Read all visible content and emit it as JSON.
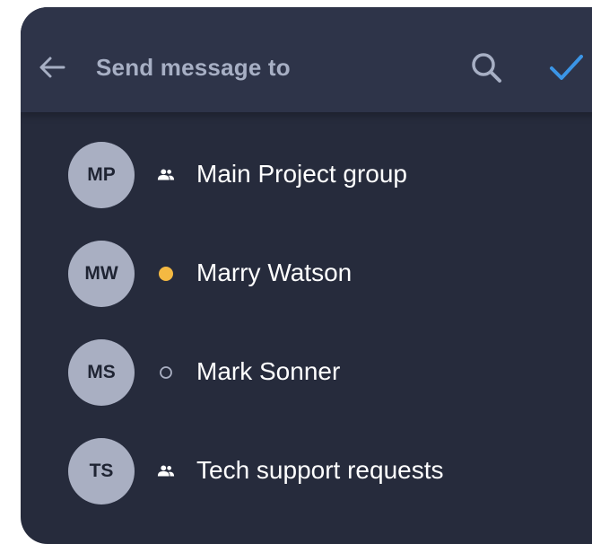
{
  "header": {
    "title": "Send message to",
    "back_icon": "arrow-left-icon",
    "search_icon": "search-icon",
    "confirm_icon": "checkmark-icon"
  },
  "contacts": [
    {
      "initials": "MP",
      "name": "Main Project group",
      "status": "group"
    },
    {
      "initials": "MW",
      "name": "Marry Watson",
      "status": "online"
    },
    {
      "initials": "MS",
      "name": "Mark Sonner",
      "status": "offline"
    },
    {
      "initials": "TS",
      "name": "Tech support requests",
      "status": "group"
    }
  ],
  "colors": {
    "panel": "#262b3c",
    "header": "#2e3449",
    "title": "#a7afc4",
    "avatar": "#a9afc2",
    "online": "#f4b942",
    "accent": "#3b95e6"
  }
}
